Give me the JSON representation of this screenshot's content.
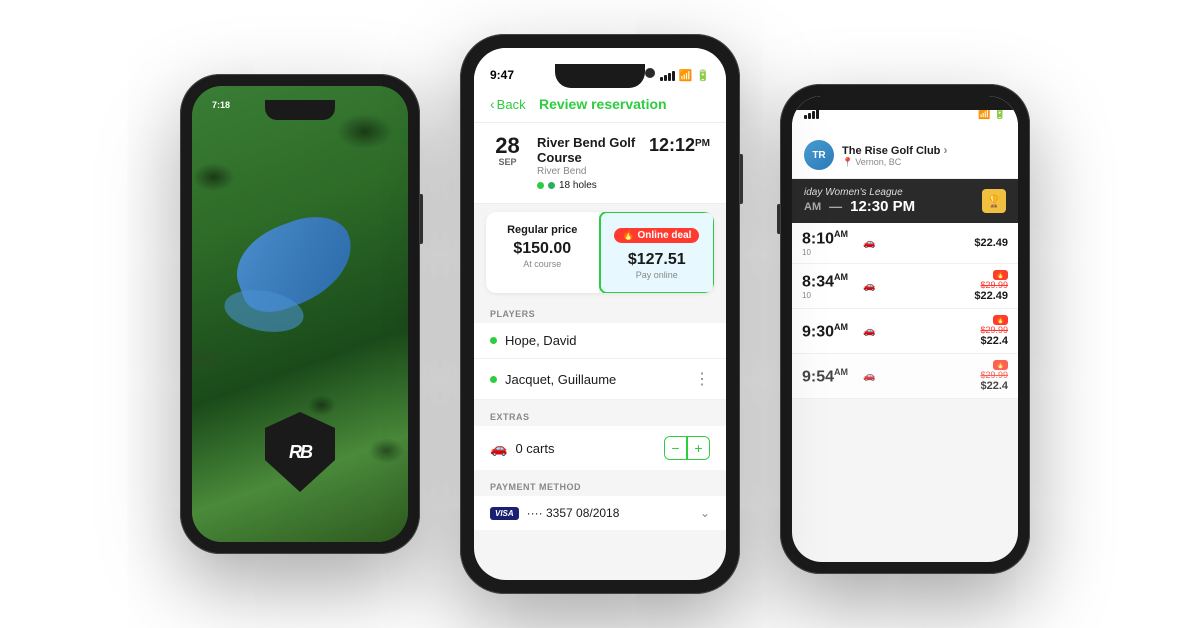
{
  "leftPhone": {
    "statusTime": "7:18",
    "shield": {
      "letters": "RB"
    }
  },
  "centerPhone": {
    "statusTime": "9:47",
    "nav": {
      "back": "Back",
      "title": "Review reservation"
    },
    "booking": {
      "day": "28",
      "month": "SEP",
      "course": "River Bend Golf Course",
      "location": "River Bend",
      "holes": "18 holes",
      "time": "12:12",
      "timeSuffix": "PM"
    },
    "pricing": {
      "regularLabel": "Regular price",
      "regularAmount": "$150.00",
      "regularSub": "At course",
      "onlineLabel": "Online deal",
      "onlineAmount": "$127.51",
      "onlineSub": "Pay online"
    },
    "playersLabel": "PLAYERS",
    "players": [
      {
        "name": "Hope, David"
      },
      {
        "name": "Jacquet, Guillaume"
      }
    ],
    "extrasLabel": "EXTRAS",
    "carts": "0 carts",
    "paymentLabel": "PAYMENT METHOD",
    "cardInfo": "···· 3357  08/2018"
  },
  "rightPhone": {
    "courseName": "The Rise Golf Club",
    "courseLocation": "Vernon, BC",
    "leagueLabel": "iday Women's League",
    "bannerTimeStart": "AM",
    "bannerTimeDash": "—",
    "bannerTimeEnd": "12:30 PM",
    "teeTimes": [
      {
        "time": "8:10",
        "ampm": "AM",
        "count": "10",
        "icon": "🚗",
        "price": "$22.49",
        "deal": false
      },
      {
        "time": "8:34",
        "ampm": "AM",
        "count": "10",
        "icon": "🚗",
        "strikeprice": "$29.99",
        "dealPrice": "$22.49",
        "deal": true
      },
      {
        "time": "9:30",
        "ampm": "AM",
        "count": "",
        "icon": "🚗",
        "strikeprice": "$29.99",
        "dealPrice": "$22.4",
        "deal": true
      },
      {
        "time": "9:54",
        "ampm": "AM",
        "count": "",
        "icon": "🚗",
        "strikeprice": "$29.99",
        "dealPrice": "$22.4",
        "deal": true
      }
    ]
  }
}
